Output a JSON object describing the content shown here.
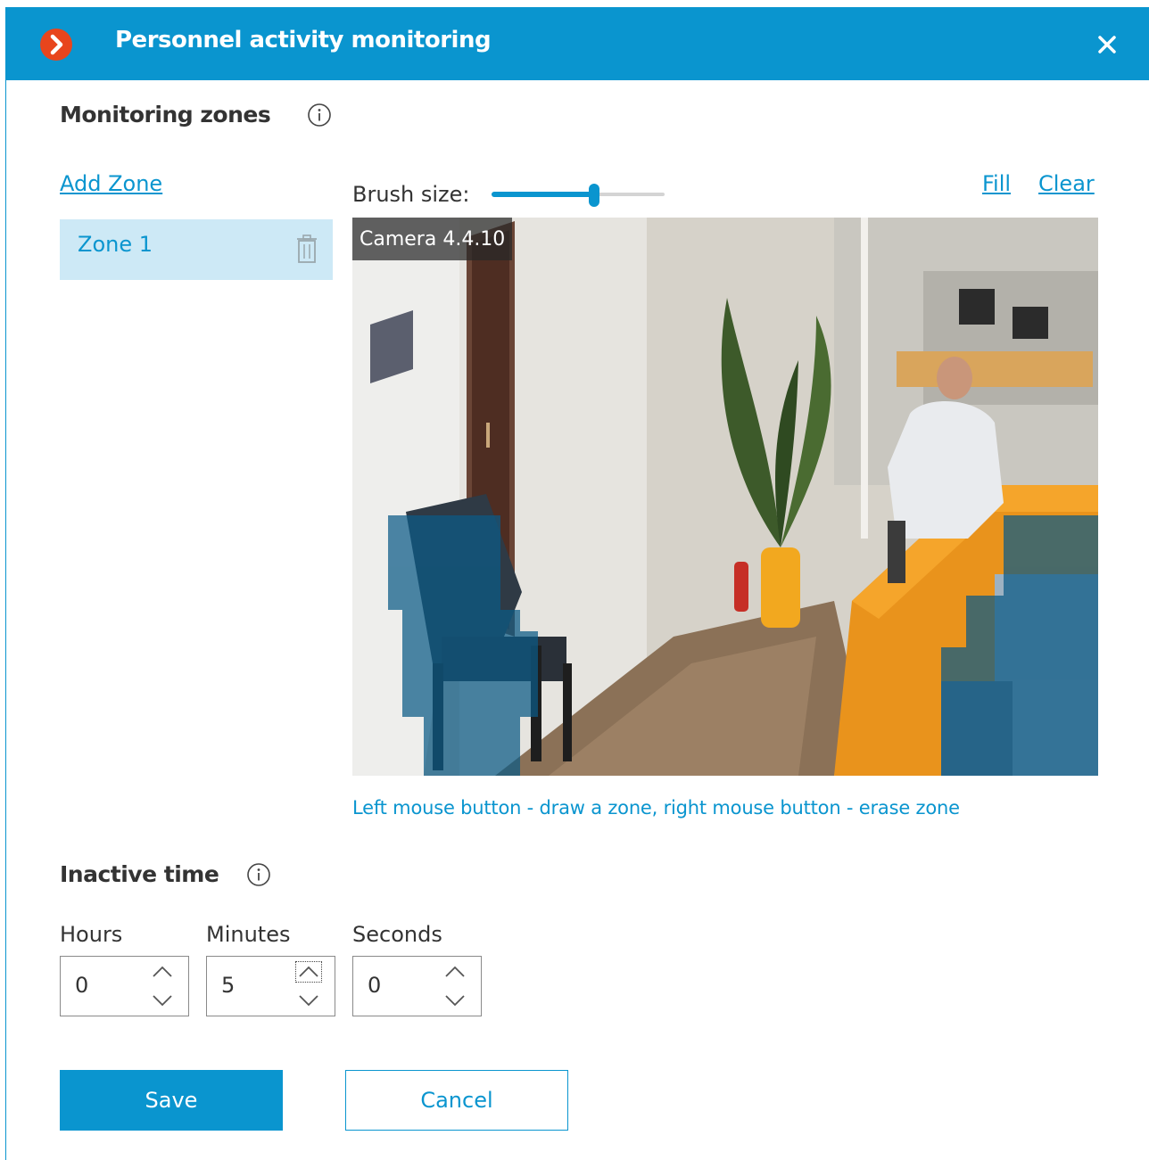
{
  "window": {
    "title": "Personnel activity monitoring",
    "icons": {
      "logo": "chevron-right-logo-icon",
      "close": "close-icon"
    },
    "colors": {
      "header": "#0a95cf",
      "logo": "#e8451d",
      "accent": "#0a95cf",
      "zone_highlight": "#cde9f6"
    }
  },
  "monitoring_zones": {
    "heading": "Monitoring zones",
    "add_zone_label": "Add Zone",
    "zones": [
      {
        "label": "Zone 1",
        "selected": true
      }
    ],
    "brush": {
      "label": "Brush size:",
      "value_fraction": 0.6
    },
    "fill_label": "Fill",
    "clear_label": "Clear",
    "camera_name": "Camera 4.4.10",
    "hint": "Left mouse button - draw a zone, right mouse button - erase zone"
  },
  "inactive_time": {
    "heading": "Inactive time",
    "fields": [
      {
        "label": "Hours",
        "value": "0"
      },
      {
        "label": "Minutes",
        "value": "5"
      },
      {
        "label": "Seconds",
        "value": "0"
      }
    ]
  },
  "buttons": {
    "save": "Save",
    "cancel": "Cancel"
  }
}
